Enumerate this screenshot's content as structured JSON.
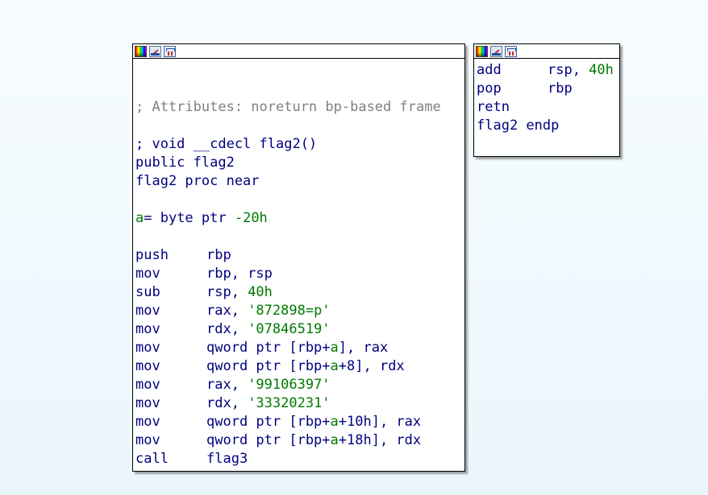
{
  "main_node": {
    "header_icons": [
      "color-icon",
      "rename-icon",
      "group-nodes-icon"
    ],
    "comment": "; Attributes: noreturn bp-based frame",
    "prototype": "; void __cdecl flag2()",
    "public_decl": "public flag2",
    "proc_decl": "flag2 proc near",
    "local_var": {
      "name": "a",
      "rest": "= byte ptr ",
      "offset": "-20h"
    },
    "instructions": [
      {
        "mnemonic": "push",
        "ops": [
          {
            "t": "rbp",
            "c": "kw"
          }
        ]
      },
      {
        "mnemonic": "mov",
        "ops": [
          {
            "t": "rbp, rsp",
            "c": "kw"
          }
        ]
      },
      {
        "mnemonic": "sub",
        "ops": [
          {
            "t": "rsp, ",
            "c": "kw"
          },
          {
            "t": "40h",
            "c": "num"
          }
        ]
      },
      {
        "mnemonic": "mov",
        "ops": [
          {
            "t": "rax, ",
            "c": "kw"
          },
          {
            "t": "'872898=p'",
            "c": "str"
          }
        ]
      },
      {
        "mnemonic": "mov",
        "ops": [
          {
            "t": "rdx, ",
            "c": "kw"
          },
          {
            "t": "'07846519'",
            "c": "str"
          }
        ]
      },
      {
        "mnemonic": "mov",
        "ops": [
          {
            "t": "qword ptr [rbp+",
            "c": "kw"
          },
          {
            "t": "a",
            "c": "var"
          },
          {
            "t": "], rax",
            "c": "kw"
          }
        ]
      },
      {
        "mnemonic": "mov",
        "ops": [
          {
            "t": "qword ptr [rbp+",
            "c": "kw"
          },
          {
            "t": "a",
            "c": "var"
          },
          {
            "t": "+8], rdx",
            "c": "kw"
          }
        ]
      },
      {
        "mnemonic": "mov",
        "ops": [
          {
            "t": "rax, ",
            "c": "kw"
          },
          {
            "t": "'99106397'",
            "c": "str"
          }
        ]
      },
      {
        "mnemonic": "mov",
        "ops": [
          {
            "t": "rdx, ",
            "c": "kw"
          },
          {
            "t": "'33320231'",
            "c": "str"
          }
        ]
      },
      {
        "mnemonic": "mov",
        "ops": [
          {
            "t": "qword ptr [rbp+",
            "c": "kw"
          },
          {
            "t": "a",
            "c": "var"
          },
          {
            "t": "+10h], rax",
            "c": "kw"
          }
        ]
      },
      {
        "mnemonic": "mov",
        "ops": [
          {
            "t": "qword ptr [rbp+",
            "c": "kw"
          },
          {
            "t": "a",
            "c": "var"
          },
          {
            "t": "+18h], rdx",
            "c": "kw"
          }
        ]
      },
      {
        "mnemonic": "call",
        "ops": [
          {
            "t": "flag3",
            "c": "kw"
          }
        ]
      }
    ]
  },
  "tail_node": {
    "header_icons": [
      "color-icon",
      "rename-icon",
      "group-nodes-icon"
    ],
    "instructions": [
      {
        "mnemonic": "add",
        "ops": [
          {
            "t": "rsp, ",
            "c": "kw"
          },
          {
            "t": "40h",
            "c": "num"
          }
        ]
      },
      {
        "mnemonic": "pop",
        "ops": [
          {
            "t": "rbp",
            "c": "kw"
          }
        ]
      },
      {
        "mnemonic": "retn",
        "ops": []
      }
    ],
    "endp": "flag2 endp"
  },
  "colors": {
    "code": "#00007f",
    "comment": "#808080",
    "immediate": "#007a00",
    "background": "#f4fbfe"
  }
}
